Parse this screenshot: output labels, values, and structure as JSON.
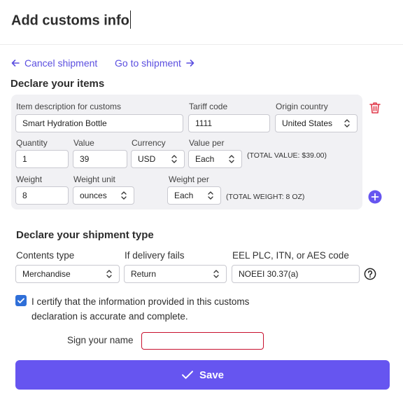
{
  "header": {
    "title": "Add customs info"
  },
  "nav": {
    "cancel_label": "Cancel shipment",
    "goto_label": "Go to shipment"
  },
  "items_section": {
    "title": "Declare your items",
    "item": {
      "description_label": "Item description for customs",
      "description_value": "Smart Hydration Bottle",
      "tariff_label": "Tariff code",
      "tariff_value": "1111",
      "origin_label": "Origin country",
      "origin_value": "United States",
      "quantity_label": "Quantity",
      "quantity_value": "1",
      "value_label": "Value",
      "value_value": "39",
      "currency_label": "Currency",
      "currency_value": "USD",
      "value_per_label": "Value per",
      "value_per_value": "Each",
      "total_value_text": "(TOTAL VALUE: $39.00)",
      "weight_label": "Weight",
      "weight_value": "8",
      "weight_unit_label": "Weight unit",
      "weight_unit_value": "ounces",
      "weight_per_label": "Weight per",
      "weight_per_value": "Each",
      "total_weight_text": "(TOTAL WEIGHT: 8 OZ)"
    },
    "delete_icon": "trash-icon",
    "add_icon": "plus-circle-icon"
  },
  "shipment_section": {
    "title": "Declare your shipment type",
    "contents_label": "Contents type",
    "contents_value": "Merchandise",
    "delivery_label": "If delivery fails",
    "delivery_value": "Return",
    "eel_label": "EEL PLC, ITN, or AES code",
    "eel_value": "NOEEI 30.37(a)",
    "help_icon": "question-circle-icon"
  },
  "certify": {
    "checked": true,
    "text": "I certify that the information provided in this customs declaration is accurate and complete."
  },
  "signature": {
    "label": "Sign your name",
    "value": ""
  },
  "save": {
    "label": "Save",
    "icon": "check-icon"
  },
  "colors": {
    "accent": "#6655f0",
    "link": "#5b4fe0",
    "danger": "#e0394a",
    "checkbox": "#2f6fd8",
    "panel_bg": "#f1f1f4"
  }
}
